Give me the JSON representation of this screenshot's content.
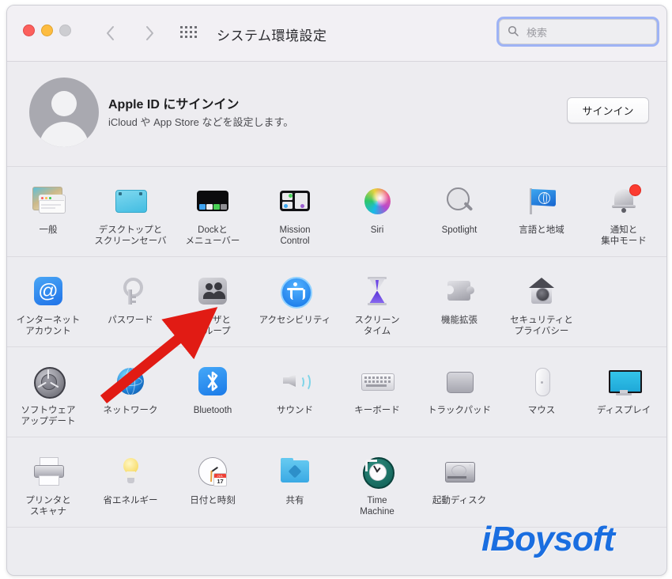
{
  "window": {
    "title": "システム環境設定"
  },
  "toolbar": {
    "back_icon": "chevron-left-icon",
    "forward_icon": "chevron-right-icon",
    "showall_icon": "grid-icon",
    "search_placeholder": "検索",
    "search_value": "",
    "search_icon": "search-icon"
  },
  "apple_id": {
    "title": "Apple ID にサインイン",
    "subtitle": "iCloud や App Store などを設定します。",
    "signin_label": "サインイン",
    "avatar_icon": "user-avatar-icon"
  },
  "groups": [
    {
      "items": [
        {
          "label": "一般",
          "icon": "general-icon"
        },
        {
          "label": "デスクトップと\nスクリーンセーバ",
          "icon": "desktop-screensaver-icon"
        },
        {
          "label": "Dockと\nメニューバー",
          "icon": "dock-menubar-icon"
        },
        {
          "label": "Mission\nControl",
          "icon": "mission-control-icon"
        },
        {
          "label": "Siri",
          "icon": "siri-icon"
        },
        {
          "label": "Spotlight",
          "icon": "spotlight-icon"
        },
        {
          "label": "言語と地域",
          "icon": "language-region-icon"
        },
        {
          "label": "通知と\n集中モード",
          "icon": "notifications-focus-icon"
        }
      ]
    },
    {
      "items": [
        {
          "label": "インターネット\nアカウント",
          "icon": "internet-accounts-icon"
        },
        {
          "label": "パスワード",
          "icon": "passwords-key-icon"
        },
        {
          "label": "ユーザと\nグループ",
          "icon": "users-groups-icon"
        },
        {
          "label": "アクセシビリティ",
          "icon": "accessibility-icon"
        },
        {
          "label": "スクリーン\nタイム",
          "icon": "screen-time-icon"
        },
        {
          "label": "機能拡張",
          "icon": "extensions-puzzle-icon"
        },
        {
          "label": "セキュリティと\nプライバシー",
          "icon": "security-privacy-icon"
        }
      ]
    },
    {
      "items": [
        {
          "label": "ソフトウェア\nアップデート",
          "icon": "software-update-icon"
        },
        {
          "label": "ネットワーク",
          "icon": "network-globe-icon"
        },
        {
          "label": "Bluetooth",
          "icon": "bluetooth-icon"
        },
        {
          "label": "サウンド",
          "icon": "sound-icon"
        },
        {
          "label": "キーボード",
          "icon": "keyboard-icon"
        },
        {
          "label": "トラックパッド",
          "icon": "trackpad-icon"
        },
        {
          "label": "マウス",
          "icon": "mouse-icon"
        },
        {
          "label": "ディスプレイ",
          "icon": "display-icon"
        }
      ]
    },
    {
      "items": [
        {
          "label": "プリンタと\nスキャナ",
          "icon": "printers-scanners-icon"
        },
        {
          "label": "省エネルギー",
          "icon": "energy-saver-icon"
        },
        {
          "label": "日付と時刻",
          "icon": "date-time-icon"
        },
        {
          "label": "共有",
          "icon": "sharing-icon"
        },
        {
          "label": "Time\nMachine",
          "icon": "time-machine-icon"
        },
        {
          "label": "起動ディスク",
          "icon": "startup-disk-icon"
        }
      ]
    }
  ],
  "date_time_icon": {
    "month": "JUL",
    "day": "17"
  },
  "annotation": {
    "arrow_color": "#e11b14",
    "points_to": "ユーザと\nグループ"
  },
  "watermark": {
    "text": "iBoysoft",
    "color": "#1a6ee0"
  }
}
